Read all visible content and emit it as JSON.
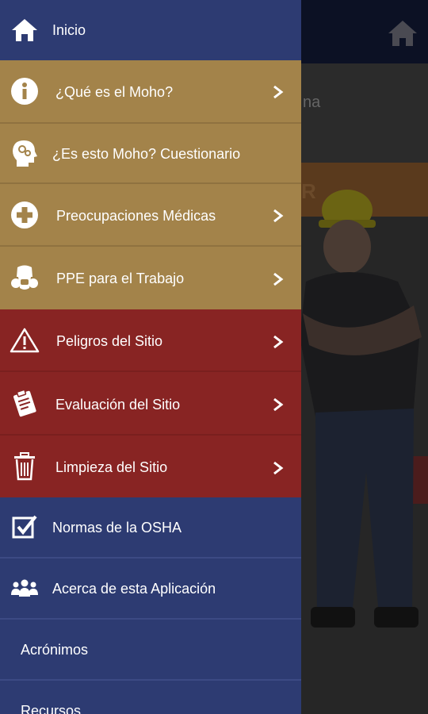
{
  "drawer": {
    "items": [
      {
        "label": "Inicio",
        "icon": "home-icon",
        "chevron": false,
        "section": "blue"
      },
      {
        "label": "¿Qué es el Moho?",
        "icon": "info-icon",
        "chevron": true,
        "section": "tan"
      },
      {
        "label": "¿Es esto Moho? Cuestionario",
        "icon": "head-gears-icon",
        "chevron": false,
        "section": "tan"
      },
      {
        "label": "Preocupaciones Médicas",
        "icon": "medical-cross-icon",
        "chevron": true,
        "section": "tan"
      },
      {
        "label": "PPE para el Trabajo",
        "icon": "respirator-icon",
        "chevron": true,
        "section": "tan"
      },
      {
        "label": "Peligros del Sitio",
        "icon": "warning-icon",
        "chevron": true,
        "section": "red"
      },
      {
        "label": "Evaluación del Sitio",
        "icon": "clipboard-icon",
        "chevron": true,
        "section": "red"
      },
      {
        "label": "Limpieza del Sitio",
        "icon": "trash-icon",
        "chevron": true,
        "section": "red"
      },
      {
        "label": "Normas de la OSHA",
        "icon": "checkbox-icon",
        "chevron": false,
        "section": "blue"
      },
      {
        "label": "Acerca de esta Aplicación",
        "icon": "group-icon",
        "chevron": false,
        "section": "blue"
      },
      {
        "label": "Acrónimos",
        "icon": "",
        "chevron": false,
        "section": "blue"
      },
      {
        "label": "Recursos",
        "icon": "",
        "chevron": false,
        "section": "blue"
      }
    ]
  },
  "background": {
    "partial_text": "na",
    "partial_banner": "R"
  },
  "colors": {
    "blue": "#2d3b72",
    "tan": "#a3834a",
    "red": "#882423",
    "topbar": "#0c1124"
  }
}
